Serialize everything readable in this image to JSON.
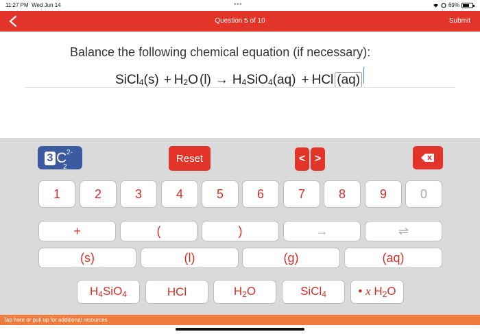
{
  "status_bar": {
    "time": "11:27 PM",
    "date": "Wed Jun 14",
    "battery": "69%",
    "battery_level": 0.69
  },
  "header": {
    "title": "Question 5 of 10",
    "submit": "Submit"
  },
  "question": {
    "prompt": "Balance the following chemical equation (if necessary):",
    "equation": {
      "r1": "SiCl",
      "r1_sub": "4",
      "r1_state": "(s)",
      "plus1": "+",
      "r2a": "H",
      "r2_sub": "2",
      "r2b": "O",
      "r2_state": "(l)",
      "arrow": "→",
      "p1a": "H",
      "p1_sub1": "4",
      "p1b": "SiO",
      "p1_sub2": "4",
      "p1_state": "(aq)",
      "plus2": "+",
      "p2": "HCl",
      "p2_state": "(aq)"
    }
  },
  "keyboard": {
    "mode": {
      "digit": "3",
      "letter": "C",
      "sub": "2",
      "sup": "2-"
    },
    "reset": "Reset",
    "nav": {
      "left": "<",
      "right": ">"
    },
    "digits": [
      "1",
      "2",
      "3",
      "4",
      "5",
      "6",
      "7",
      "8",
      "9",
      "0"
    ],
    "ops": {
      "plus": "+",
      "open_paren": "(",
      "close_paren": ")",
      "arrow": "→",
      "equilibrium": "⇌"
    },
    "states": [
      "(s)",
      "(l)",
      "(g)",
      "(aq)"
    ],
    "formulas": {
      "h4sio4": {
        "a": "H",
        "s1": "4",
        "b": "SiO",
        "s2": "4"
      },
      "hcl": "HCl",
      "h2o": {
        "a": "H",
        "s1": "2",
        "b": "O"
      },
      "sicl4": {
        "a": "SiCl",
        "s1": "4"
      },
      "hydrate": {
        "dot": "•",
        "x": "x",
        "a": "H",
        "s1": "2",
        "b": "O"
      }
    }
  },
  "footer": {
    "text": "Tap here or pull up for additional resources"
  },
  "colors": {
    "accent": "#e3342a",
    "mode_button": "#3b5aa0",
    "footer": "#ef7c3c",
    "keyboard_bg": "#dadada"
  }
}
